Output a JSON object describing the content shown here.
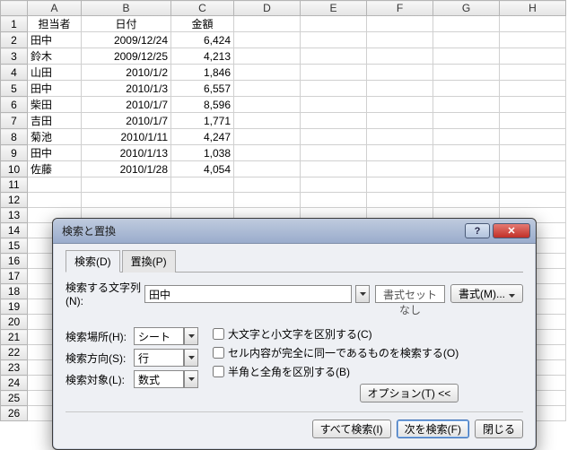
{
  "sheet": {
    "col_headers": [
      "A",
      "B",
      "C",
      "D",
      "E",
      "F",
      "G",
      "H"
    ],
    "row_headers": [
      "1",
      "2",
      "3",
      "4",
      "5",
      "6",
      "7",
      "8",
      "9",
      "10",
      "11",
      "12",
      "13",
      "14",
      "15",
      "16",
      "17",
      "18",
      "19",
      "20",
      "21",
      "22",
      "23",
      "24",
      "25",
      "26"
    ],
    "header_row": {
      "A": "担当者",
      "B": "日付",
      "C": "金額"
    },
    "data_rows": [
      {
        "A": "田中",
        "B": "2009/12/24",
        "C": "6,424"
      },
      {
        "A": "鈴木",
        "B": "2009/12/25",
        "C": "4,213"
      },
      {
        "A": "山田",
        "B": "2010/1/2",
        "C": "1,846"
      },
      {
        "A": "田中",
        "B": "2010/1/3",
        "C": "6,557"
      },
      {
        "A": "柴田",
        "B": "2010/1/7",
        "C": "8,596"
      },
      {
        "A": "吉田",
        "B": "2010/1/7",
        "C": "1,771"
      },
      {
        "A": "菊池",
        "B": "2010/1/11",
        "C": "4,247"
      },
      {
        "A": "田中",
        "B": "2010/1/13",
        "C": "1,038"
      },
      {
        "A": "佐藤",
        "B": "2010/1/28",
        "C": "4,054"
      }
    ]
  },
  "dialog": {
    "title": "検索と置換",
    "help": "?",
    "close": "✕",
    "tabs": {
      "search": "検索(D)",
      "replace": "置換(P)"
    },
    "find_label": "検索する文字列(N):",
    "find_value": "田中",
    "format_none": "書式セットなし",
    "format_btn": "書式(M)...",
    "within_label": "検索場所(H):",
    "within_value": "シート",
    "direction_label": "検索方向(S):",
    "direction_value": "行",
    "lookin_label": "検索対象(L):",
    "lookin_value": "数式",
    "check_case": "大文字と小文字を区別する(C)",
    "check_whole": "セル内容が完全に同一であるものを検索する(O)",
    "check_width": "半角と全角を区別する(B)",
    "options_btn": "オプション(T) <<",
    "find_all": "すべて検索(I)",
    "find_next": "次を検索(F)",
    "close_btn": "閉じる"
  }
}
